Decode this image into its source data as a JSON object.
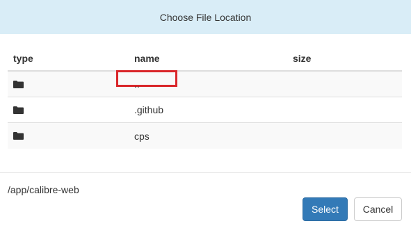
{
  "dialog": {
    "title": "Choose File Location"
  },
  "table": {
    "headers": {
      "type": "type",
      "name": "name",
      "size": "size"
    },
    "rows": [
      {
        "type_icon": "folder-icon",
        "name": "..",
        "size": ""
      },
      {
        "type_icon": "folder-icon",
        "name": ".github",
        "size": ""
      },
      {
        "type_icon": "folder-icon",
        "name": "cps",
        "size": ""
      }
    ]
  },
  "footer": {
    "current_path": "/app/calibre-web",
    "select_label": "Select",
    "cancel_label": "Cancel"
  },
  "colors": {
    "header_bg": "#d9edf7",
    "primary": "#337ab7",
    "highlight": "#d9262a"
  }
}
